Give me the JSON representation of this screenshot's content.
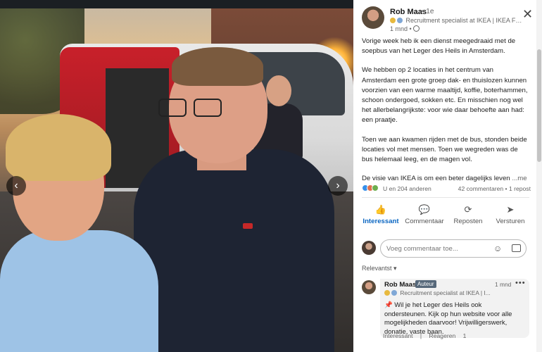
{
  "photo": {
    "prev_glyph": "‹",
    "next_glyph": "›",
    "prev_icon": "chevron-left-icon",
    "next_icon": "chevron-right-icon"
  },
  "post": {
    "author": "Rob Maas",
    "degree": "• 1e",
    "headline": "Recruitment specialist at IKEA | IKEA Fo...",
    "time": "1 mnd •",
    "close_glyph": "✕",
    "paragraphs": [
      "Vorige week heb ik een dienst meegedraaid met de soepbus van het Leger des Heils in Amsterdam.",
      "We hebben op 2 locaties in het centrum van Amsterdam een grote groep dak- en thuislozen kunnen voorzien van een warme maaltijd, koffie, boterhammen, schoon ondergoed, sokken etc. En misschien nog wel het allerbelangrijkste: voor wie daar behoefte aan had: een praatje.",
      "Toen we aan kwamen rijden met de bus, stonden beide locaties vol met mensen. Toen we wegreden was de bus helemaal leeg, en de magen vol."
    ],
    "truncated_line": "De visie van IKEA is om een beter dagelijks leven",
    "more_label": "...me"
  },
  "social": {
    "reactions_text": "U en 204 anderen",
    "comments_text": "42 commentaren • 1 repost",
    "reaction_colors": [
      "#378fe9",
      "#df704d",
      "#6dae4f"
    ]
  },
  "actions": [
    {
      "label": "Interessant",
      "icon": "thumbs-up-icon",
      "glyph": "👍"
    },
    {
      "label": "Commentaar",
      "icon": "comment-icon",
      "glyph": "💬"
    },
    {
      "label": "Reposten",
      "icon": "repost-icon",
      "glyph": "⟳"
    },
    {
      "label": "Versturen",
      "icon": "send-icon",
      "glyph": "➤"
    }
  ],
  "comment_input": {
    "placeholder": "Voeg commentaar toe...",
    "emoji_glyph": "☺"
  },
  "sort": {
    "label": "Relevantst ▾"
  },
  "comment": {
    "author": "Rob Maas",
    "badge": "Auteur",
    "time": "1 mnd",
    "dots": "•••",
    "headline": "Recruitment specialist at IKEA | I...",
    "pin": "📌",
    "text": " Wil je het Leger des Heils ook ondersteunen. Kijk op hun website voor alle mogelijkheden daarvoor! Vrijwilligerswerk, donatie, vaste baan.",
    "like_label": "Interessant",
    "reply_label": "Reageren",
    "reply_count": "1"
  },
  "colors": {
    "accent": "#0a66c2",
    "badge_bg": "#56687a"
  }
}
